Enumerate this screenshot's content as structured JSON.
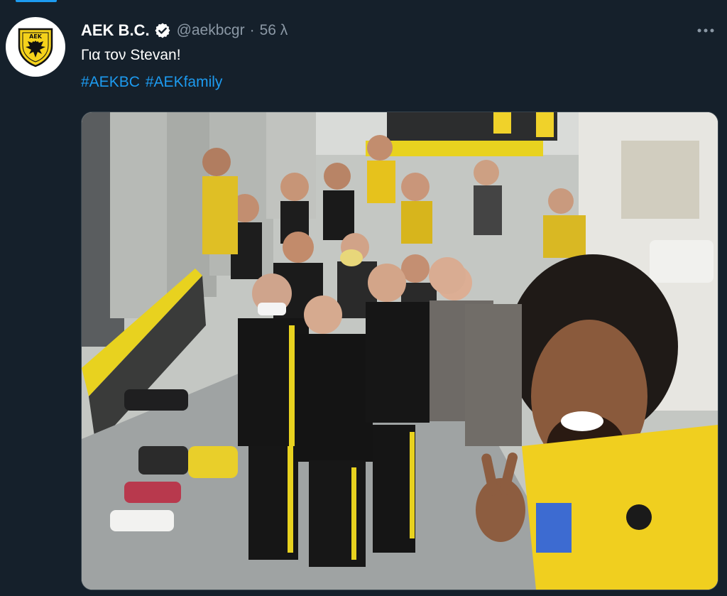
{
  "tweet": {
    "author": {
      "display_name": "AEK B.C.",
      "handle": "@aekbcgr",
      "avatar_icon": "aek-crest-icon",
      "verified": true
    },
    "separator": "·",
    "timestamp": "56 λ",
    "text": "Για τον Stevan!",
    "hashtags": [
      "#AEKBC",
      "#AEKfamily"
    ],
    "media": {
      "type": "photo"
    }
  },
  "icons": {
    "verified": "verified-badge-icon",
    "more": "more-options-icon"
  },
  "colors": {
    "background": "#15202b",
    "text_primary": "#ffffff",
    "text_secondary": "#8b98a5",
    "link": "#1d9bf0",
    "aek_yellow": "#f5d21b",
    "aek_black": "#111111"
  }
}
